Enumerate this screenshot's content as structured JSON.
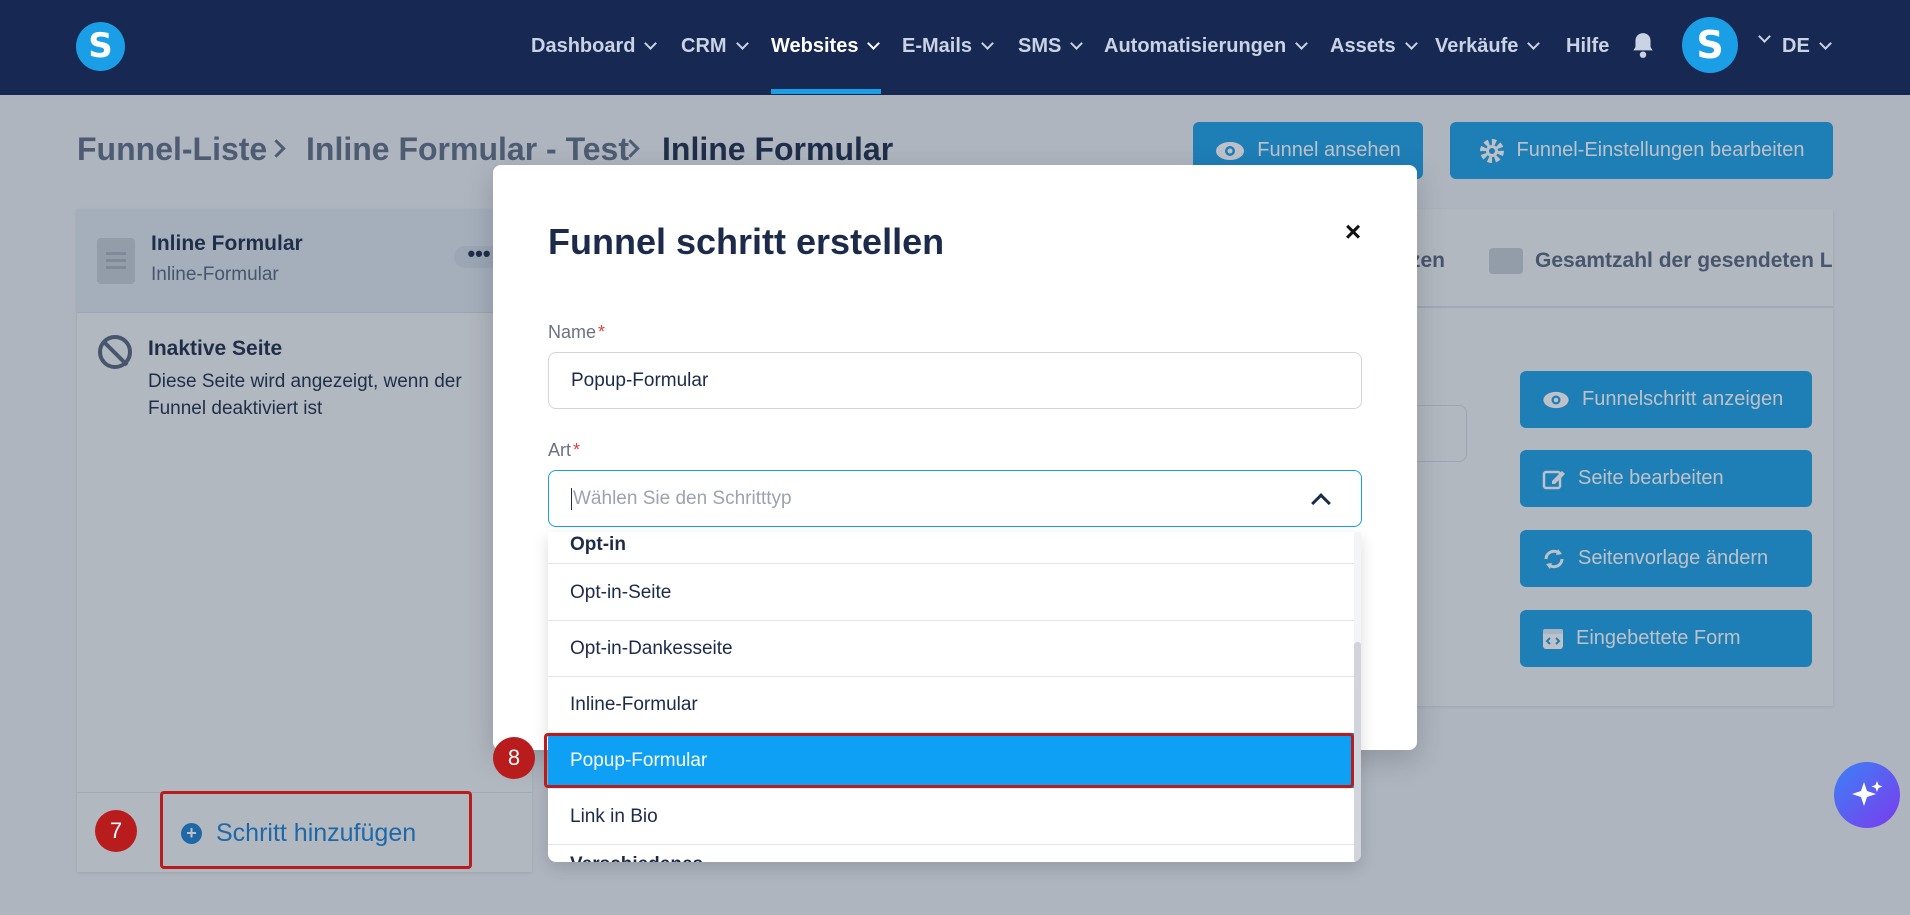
{
  "app": {
    "logo_letter": "S"
  },
  "navbar": {
    "items": [
      {
        "label": "Dashboard",
        "dropdown": true
      },
      {
        "label": "CRM",
        "dropdown": true
      },
      {
        "label": "Websites",
        "dropdown": true,
        "active": true
      },
      {
        "label": "E-Mails",
        "dropdown": true
      },
      {
        "label": "SMS",
        "dropdown": true
      },
      {
        "label": "Automatisierungen",
        "dropdown": true
      },
      {
        "label": "Assets",
        "dropdown": true
      },
      {
        "label": "Verkäufe",
        "dropdown": true
      },
      {
        "label": "Hilfe",
        "dropdown": false
      }
    ],
    "bell_icon": "bell-icon",
    "avatar_letter": "S",
    "language": "DE"
  },
  "breadcrumb": {
    "items": [
      "Funnel-Liste",
      "Inline Formular - Test",
      "Inline Formular"
    ]
  },
  "header_actions": {
    "view_funnel": "Funnel ansehen",
    "edit_settings": "Funnel-Einstellungen bearbeiten"
  },
  "step_list": {
    "current_step": {
      "title": "Inline Formular",
      "subtitle": "Inline-Formular",
      "menu": "•••"
    },
    "inactive_page": {
      "title": "Inaktive Seite",
      "description": "Diese Seite wird angezeigt, wenn der Funnel deaktiviert ist"
    },
    "add_step": "Schritt hinzufügen"
  },
  "right_panel": {
    "tab_partial": "zen",
    "tab_total_sent": "Gesamtzahl der gesendeten L",
    "actions": [
      {
        "label": "Funnelschritt anzeigen",
        "icon": "eye-icon"
      },
      {
        "label": "Seite bearbeiten",
        "icon": "edit-icon"
      },
      {
        "label": "Seitenvorlage ändern",
        "icon": "refresh-icon"
      },
      {
        "label": "Eingebettete Form",
        "icon": "embed-icon"
      }
    ]
  },
  "modal": {
    "title": "Funnel schritt erstellen",
    "close": "×",
    "name_label": "Name",
    "name_value": "Popup-Formular",
    "type_label": "Art",
    "required_mark": "*",
    "type_placeholder": "Wählen Sie den Schritttyp"
  },
  "dropdown": {
    "group_label": "Opt-in",
    "options": [
      "Opt-in-Seite",
      "Opt-in-Dankesseite",
      "Inline-Formular",
      "Popup-Formular",
      "Link in Bio"
    ],
    "selected": "Popup-Formular",
    "next_group_partial": "Verschiedenes"
  },
  "annotations": {
    "step7": "7",
    "step8": "8"
  },
  "colors": {
    "navbar": "#172952",
    "accent": "#1a9ee6",
    "selected_option": "#0ea0f5",
    "highlight": "#b91c1c"
  }
}
